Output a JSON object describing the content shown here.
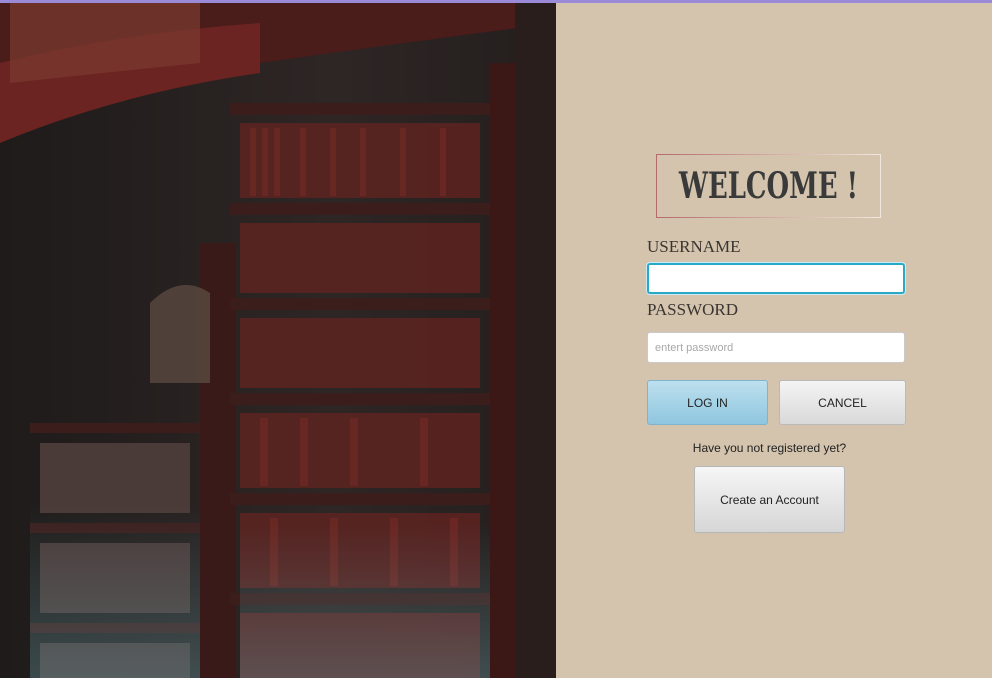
{
  "welcome": {
    "title": "WELCOME !"
  },
  "username": {
    "label": "USERNAME",
    "value": "",
    "placeholder": ""
  },
  "password": {
    "label": "PASSWORD",
    "value": "",
    "placeholder": "entert password"
  },
  "buttons": {
    "login": "LOG IN",
    "cancel": "CANCEL",
    "create_account": "Create an Account"
  },
  "register_prompt": "Have you not registered yet?",
  "colors": {
    "panel_background": "#d4c4ae",
    "accent_blue": "#29a9c7",
    "login_button": "#a7d3e6",
    "top_strip": "#9a8ad8"
  },
  "icons": {
    "background_image": "library-bookshelf-image"
  }
}
